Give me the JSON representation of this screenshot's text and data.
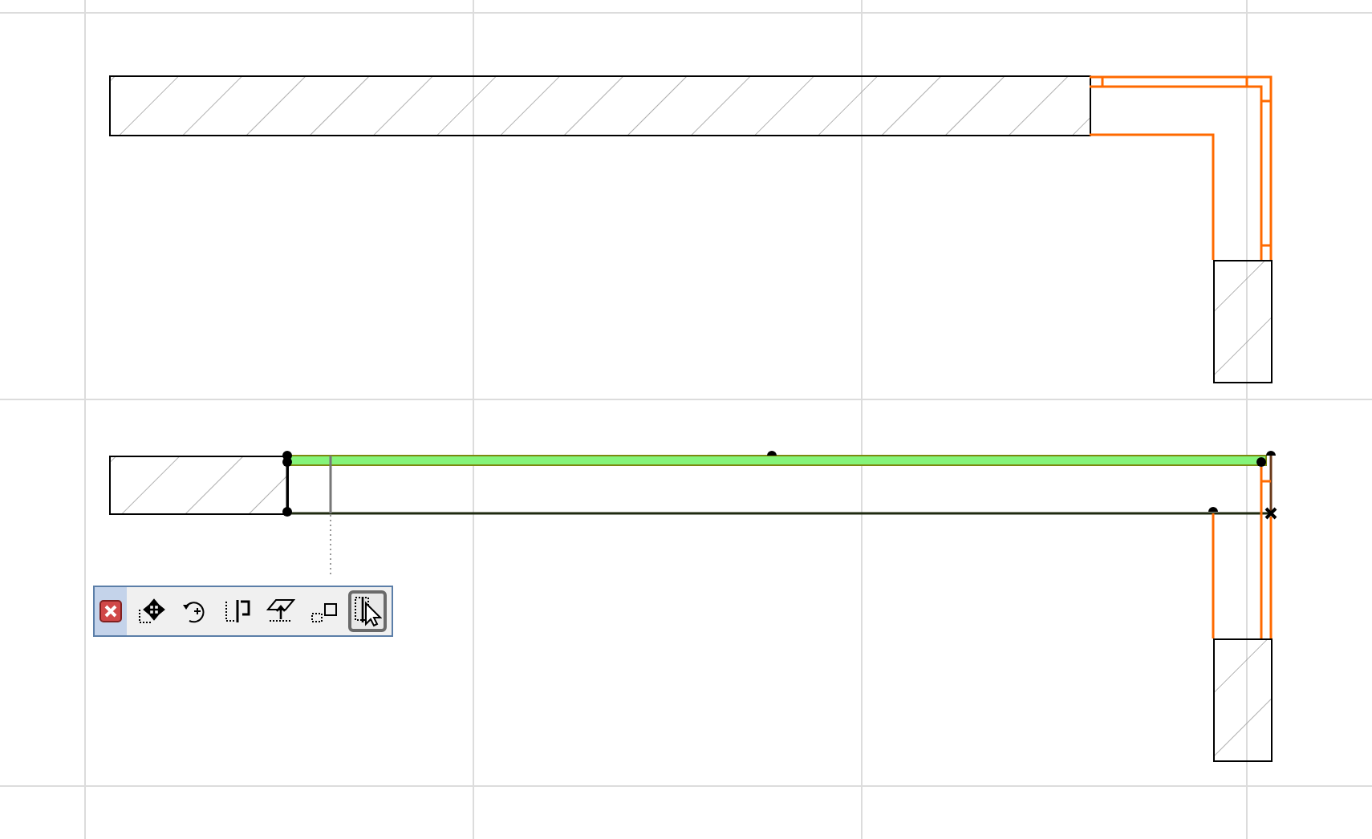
{
  "pet_palette": {
    "buttons": [
      {
        "kind": "close",
        "selected": false
      },
      {
        "kind": "drag",
        "selected": false
      },
      {
        "kind": "rotate",
        "selected": false
      },
      {
        "kind": "mirror",
        "selected": false
      },
      {
        "kind": "elevate",
        "selected": false
      },
      {
        "kind": "multiply",
        "selected": false
      },
      {
        "kind": "offset",
        "selected": true
      }
    ]
  }
}
